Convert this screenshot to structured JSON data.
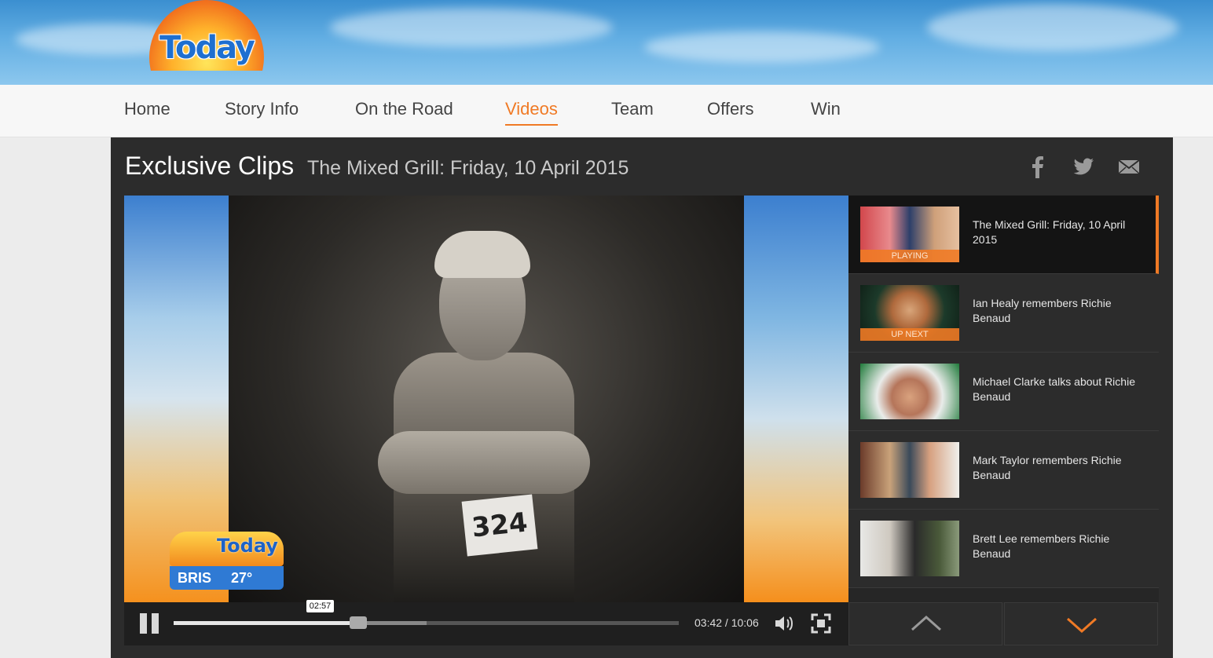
{
  "brand": {
    "logo_text": "Today",
    "accent": "#f07a25"
  },
  "nav": {
    "items": [
      {
        "label": "Home",
        "active": false
      },
      {
        "label": "Story Info",
        "active": false
      },
      {
        "label": "On the Road",
        "active": false
      },
      {
        "label": "Videos",
        "active": true
      },
      {
        "label": "Team",
        "active": false
      },
      {
        "label": "Offers",
        "active": false
      },
      {
        "label": "Win",
        "active": false
      }
    ]
  },
  "page": {
    "title": "Exclusive Clips",
    "subtitle": "The Mixed Grill: Friday, 10 April 2015",
    "share_icons": [
      "facebook-icon",
      "twitter-icon",
      "email-icon"
    ]
  },
  "video": {
    "bib_number": "324",
    "bug": {
      "logo_text": "Today",
      "city": "BRIS",
      "temperature": "27°"
    },
    "controls": {
      "tooltip_time": "02:57",
      "current_time": "03:42",
      "duration": "10:06",
      "time_display": "03:42 / 10:06",
      "played_fraction": 0.366,
      "buffered_fraction": 0.5
    }
  },
  "playlist": {
    "items": [
      {
        "title": "The Mixed Grill: Friday, 10 April 2015",
        "tag": "PLAYING"
      },
      {
        "title": "Ian Healy remembers Richie Benaud",
        "tag": "UP NEXT"
      },
      {
        "title": "Michael Clarke talks about Richie Benaud",
        "tag": ""
      },
      {
        "title": "Mark Taylor remembers Richie Benaud",
        "tag": ""
      },
      {
        "title": "Brett Lee remembers Richie Benaud",
        "tag": ""
      }
    ]
  }
}
